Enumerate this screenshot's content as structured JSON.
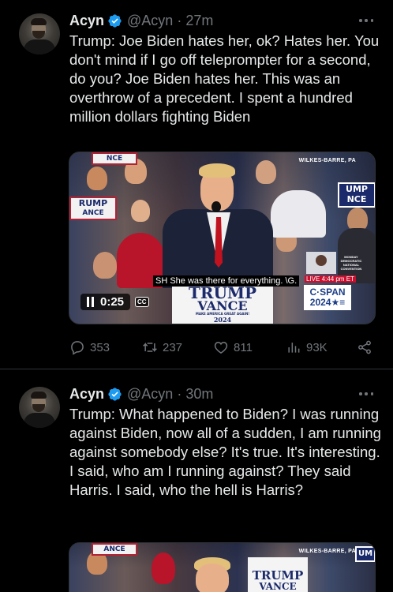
{
  "tweets": [
    {
      "author_name": "Acyn",
      "author_handle": "@Acyn",
      "time": "27m",
      "text": "Trump: Joe Biden hates her, ok? Hates her. You don't mind if I go off teleprompter for a second, do you? Joe Biden hates her. This was an overthrow of a precedent. I spent a hundred million dollars fighting Biden",
      "video": {
        "location_banner": "WILKES-BARRE, PA",
        "caption": "SH She was there for everything. \\G.",
        "podium_line1": "TRUMP",
        "podium_line2": "VANCE",
        "podium_tagline": "MAKE AMERICA GREAT AGAIN!",
        "podium_year": "2024",
        "sign_left_top": "NCE",
        "sign_left": "RUMP",
        "sign_left2": "ANCE",
        "sign_right": "UMP",
        "sign_right2": "NCE",
        "inset_label1": "MONDAY",
        "inset_label2": "DEMOCRATIC NATIONAL CONVENTION",
        "live_label": "LIVE 4:44 pm ET",
        "network_line1": "C·SPAN",
        "network_line2": "2024★≡",
        "elapsed": "0:25",
        "cc_label": "CC"
      },
      "stats": {
        "replies": "353",
        "retweets": "237",
        "likes": "811",
        "views": "93K"
      }
    },
    {
      "author_name": "Acyn",
      "author_handle": "@Acyn",
      "time": "30m",
      "text": "Trump: What happened to Biden? I was running against Biden, now all of a sudden, I am running against somebody else? It's true. It's interesting. I said, who am I running against? They said Harris. I said, who the hell is Harris?",
      "video": {
        "location_banner": "WILKES-BARRE, PA",
        "podium_line1": "TRUMP",
        "podium_line2": "VANCE",
        "sign_left": "ANCE",
        "sign_right": "UM"
      }
    }
  ],
  "colors": {
    "background": "#000000",
    "text_primary": "#e7e9ea",
    "text_secondary": "#71767b",
    "verified_blue": "#1d9bf0",
    "divider": "#2f3336"
  },
  "icons": [
    "verified-badge-icon",
    "more-icon",
    "pause-icon",
    "reply-icon",
    "retweet-icon",
    "like-icon",
    "views-icon",
    "share-icon"
  ]
}
